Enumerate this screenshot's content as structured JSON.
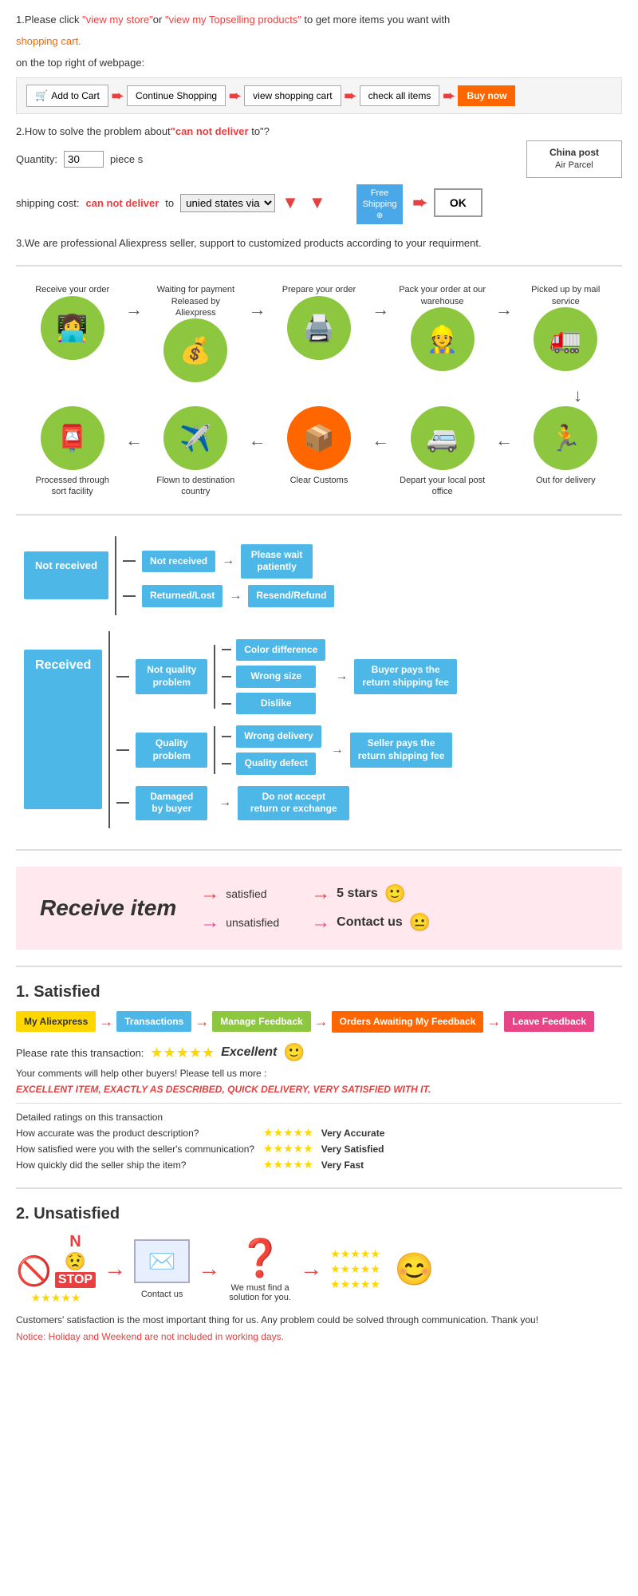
{
  "section1": {
    "text1": "1.Please click ",
    "link1": "\"view my store\"",
    "text2": "or ",
    "link2": "\"view my Topselling products\"",
    "text3": " to get more items you want with",
    "text4": "shopping cart.",
    "text5": "on the top right of webpage:",
    "steps": [
      {
        "label": "Add to Cart",
        "type": "cart"
      },
      {
        "label": "Continue Shopping",
        "type": "normal"
      },
      {
        "label": "view shopping cart",
        "type": "normal"
      },
      {
        "label": "check all items",
        "type": "normal"
      },
      {
        "label": "Buy now",
        "type": "buynow"
      }
    ]
  },
  "section2": {
    "title": "2.How to solve the problem about",
    "cannot": "\"can not deliver",
    "title2": " to\"?",
    "qty_label": "Quantity:",
    "qty_value": "30",
    "piece_label": "piece s",
    "shipping_label": "shipping cost:",
    "cannot2": "can not deliver",
    "to_label": " to ",
    "via_label": "unied states via",
    "china_post_title": "China post",
    "china_post_subtitle": "Air Parcel",
    "free_shipping": "Free\nShipping",
    "ok_label": "OK"
  },
  "section3": {
    "text": "3.We are professional Aliexpress seller, support to customized products according to your requirment."
  },
  "process": {
    "row1": [
      {
        "label": "Receive your order",
        "icon": "👩‍💻"
      },
      {
        "label": "Waiting for payment Released by Aliexpress",
        "icon": "💰"
      },
      {
        "label": "Prepare your order",
        "icon": "🖨️"
      },
      {
        "label": "Pack your order at our warehouse",
        "icon": "👷"
      },
      {
        "label": "Picked up by mail service",
        "icon": "🚛"
      }
    ],
    "row2": [
      {
        "label": "Out for delivery",
        "icon": "🏃"
      },
      {
        "label": "Depart your local post office",
        "icon": "🚐"
      },
      {
        "label": "Clear Customs",
        "icon": "📦"
      },
      {
        "label": "Flown to destination country",
        "icon": "✈️"
      },
      {
        "label": "Processed through sort facility",
        "icon": "📮"
      }
    ]
  },
  "resolution": {
    "not_received": "Not received",
    "not_received_sub1": "Not received",
    "not_received_sub2": "Returned/Lost",
    "please_wait": "Please wait\npatiently",
    "resend_refund": "Resend/Refund",
    "received": "Received",
    "not_quality": "Not quality\nproblem",
    "quality_problem": "Quality\nproblem",
    "damaged_buyer": "Damaged\nby buyer",
    "color_diff": "Color difference",
    "wrong_size": "Wrong size",
    "dislike": "Dislike",
    "wrong_delivery": "Wrong delivery",
    "quality_defect": "Quality defect",
    "do_not_accept": "Do not accept\nreturn or exchange",
    "buyer_pays": "Buyer pays the\nreturn shipping fee",
    "seller_pays": "Seller pays the\nreturn shipping fee"
  },
  "receive_section": {
    "title": "Receive item",
    "satisfied": "satisfied",
    "unsatisfied": "unsatisfied",
    "five_stars": "5 stars",
    "contact_us": "Contact us",
    "smiley_happy": "🙂",
    "smiley_neutral": "😐"
  },
  "satisfied": {
    "heading": "1. Satisfied",
    "steps": [
      {
        "label": "My Aliexpress",
        "type": "yellow"
      },
      {
        "label": "Transactions",
        "type": "blue"
      },
      {
        "label": "Manage Feedback",
        "type": "green"
      },
      {
        "label": "Orders Awaiting My Feedback",
        "type": "orange"
      },
      {
        "label": "Leave Feedback",
        "type": "pink"
      }
    ],
    "rate_label": "Please rate this transaction:",
    "stars": "★★★★★",
    "excellent": "Excellent",
    "smiley": "🙂",
    "comment1": "Your comments will help other buyers! Please tell us more :",
    "excellent_comment": "EXCELLENT ITEM, EXACTLY AS DESCRIBED, QUICK DELIVERY, VERY SATISFIED WITH IT.",
    "detailed_label": "Detailed ratings on this transaction",
    "ratings": [
      {
        "label": "How accurate was the product description?",
        "stars": "★★★★★",
        "value": "Very Accurate"
      },
      {
        "label": "How satisfied were you with the seller's communication?",
        "stars": "★★★★★",
        "value": "Very Satisfied"
      },
      {
        "label": "How quickly did the seller ship the item?",
        "stars": "★★★★★",
        "value": "Very Fast"
      }
    ]
  },
  "unsatisfied": {
    "heading": "2. Unsatisfied",
    "contact_us": "Contact us",
    "find_solution": "We must find a solution for you.",
    "notice": "Customers' satisfaction is the most important thing for us. Any problem could be solved through communication. Thank you!",
    "notice2": "Notice: Holiday and Weekend are not included in working days."
  }
}
